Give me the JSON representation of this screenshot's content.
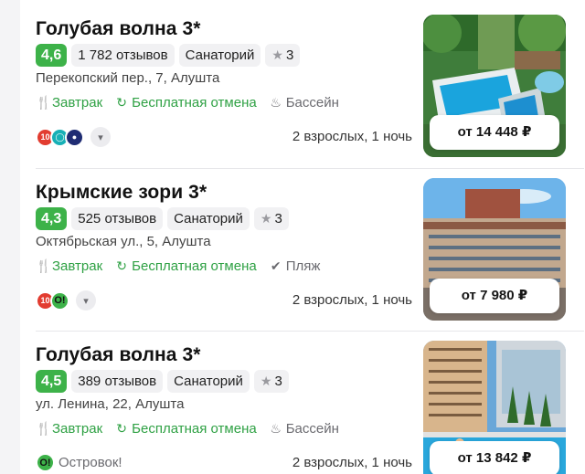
{
  "hotels": [
    {
      "title": "Голубая волна 3*",
      "rating": "4,6",
      "reviews": "1 782 отзывов",
      "type": "Санаторий",
      "stars": "3",
      "address": "Перекопский пер., 7, Алушта",
      "features": [
        {
          "label": "Завтрак",
          "icon": "fork-knife-icon",
          "color": "green"
        },
        {
          "label": "Бесплатная отмена",
          "icon": "refresh-icon",
          "color": "green"
        },
        {
          "label": "Бассейн",
          "icon": "pool-icon",
          "color": "grey"
        }
      ],
      "partner_logos": [
        "101",
        "ostrovok",
        "teal",
        "navy"
      ],
      "guests": "2 взрослых, 1 ночь",
      "price": "от 14 448 ₽"
    },
    {
      "title": "Крымские зори 3*",
      "rating": "4,3",
      "reviews": "525 отзывов",
      "type": "Санаторий",
      "stars": "3",
      "address": "Октябрьская ул., 5, Алушта",
      "features": [
        {
          "label": "Завтрак",
          "icon": "fork-knife-icon",
          "color": "green"
        },
        {
          "label": "Бесплатная отмена",
          "icon": "refresh-icon",
          "color": "green"
        },
        {
          "label": "Пляж",
          "icon": "check-icon",
          "color": "grey"
        }
      ],
      "partner_logos": [
        "101",
        "ostrovok"
      ],
      "guests": "2 взрослых, 1 ночь",
      "price": "от 7 980 ₽"
    },
    {
      "title": "Голубая волна 3*",
      "rating": "4,5",
      "reviews": "389 отзывов",
      "type": "Санаторий",
      "stars": "3",
      "address": "ул. Ленина, 22, Алушта",
      "features": [
        {
          "label": "Завтрак",
          "icon": "fork-knife-icon",
          "color": "green"
        },
        {
          "label": "Бесплатная отмена",
          "icon": "refresh-icon",
          "color": "green"
        },
        {
          "label": "Бассейн",
          "icon": "pool-icon",
          "color": "grey"
        }
      ],
      "partner": "Островок!",
      "guests": "2 взрослых, 1 ночь",
      "price": "от 13 842 ₽"
    }
  ],
  "logo_text": {
    "l101": "10",
    "ostrovok": "O!"
  },
  "colors": {
    "rating_green": "#3db249",
    "feature_green": "#2fa144",
    "logo_101": "#e23c30"
  }
}
